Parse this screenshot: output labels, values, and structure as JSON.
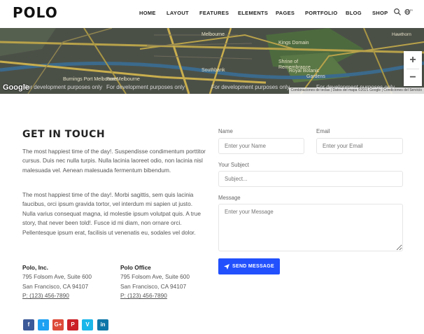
{
  "header": {
    "logo": "POLO",
    "nav": [
      "HOME",
      "LAYOUT",
      "FEATURES",
      "ELEMENTS",
      "PAGES",
      "PORTFOLIO",
      "BLOG",
      "SHOP"
    ],
    "language_badge": "EN",
    "icons": [
      "search-icon",
      "globe-icon"
    ]
  },
  "map": {
    "labels": [
      "Kings Domain",
      "Shrine of Remembrance",
      "Royal Botanic",
      "Gardens",
      "Southbank",
      "Burnings Port Melbourne",
      "Port Melbourne",
      "Melbourne",
      "Hawthorn"
    ],
    "dev_notice": "For development purposes only",
    "google": "Google",
    "attribution": "Combinaciones de teclas | Datos del mapa ©2021 Google | Condiciones del Servicio",
    "zoom_in": "+",
    "zoom_out": "−"
  },
  "contact": {
    "title": "GET IN TOUCH",
    "paragraph1": "The most happiest time of the day!. Suspendisse condimentum porttitor cursus. Duis nec nulla turpis. Nulla lacinia laoreet odio, non lacinia nisl malesuada vel. Aenean malesuada fermentum bibendum.",
    "paragraph2": "The most happiest time of the day!. Morbi sagittis, sem quis lacinia faucibus, orci ipsum gravida tortor, vel interdum mi sapien ut justo. Nulla varius consequat magna, id molestie ipsum volutpat quis. A true story, that never been told!. Fusce id mi diam, non ornare orci. Pellentesque ipsum erat, facilisis ut venenatis eu, sodales vel dolor.",
    "addresses": [
      {
        "name": "Polo, Inc.",
        "street": "795 Folsom Ave, Suite 600",
        "city": "San Francisco, CA 94107",
        "phone": "P: (123) 456-7890"
      },
      {
        "name": "Polo Office",
        "street": "795 Folsom Ave, Suite 600",
        "city": "San Francisco, CA 94107",
        "phone": "P: (123) 456-7890"
      }
    ],
    "social": [
      {
        "icon": "facebook-icon",
        "glyph": "f",
        "color": "#3b5998"
      },
      {
        "icon": "twitter-icon",
        "glyph": "t",
        "color": "#1da1f2"
      },
      {
        "icon": "google-plus-icon",
        "glyph": "G+",
        "color": "#dd4b39"
      },
      {
        "icon": "pinterest-icon",
        "glyph": "P",
        "color": "#cb2027"
      },
      {
        "icon": "vimeo-icon",
        "glyph": "V",
        "color": "#1ab7ea"
      },
      {
        "icon": "linkedin-icon",
        "glyph": "in",
        "color": "#0e76a8"
      }
    ]
  },
  "form": {
    "name_label": "Name",
    "name_placeholder": "Enter your Name",
    "email_label": "Email",
    "email_placeholder": "Enter your Email",
    "subject_label": "Your Subject",
    "subject_placeholder": "Subject...",
    "message_label": "Message",
    "message_placeholder": "Enter your Message",
    "send_label": "SEND MESSAGE",
    "accent": "#2250fc"
  }
}
